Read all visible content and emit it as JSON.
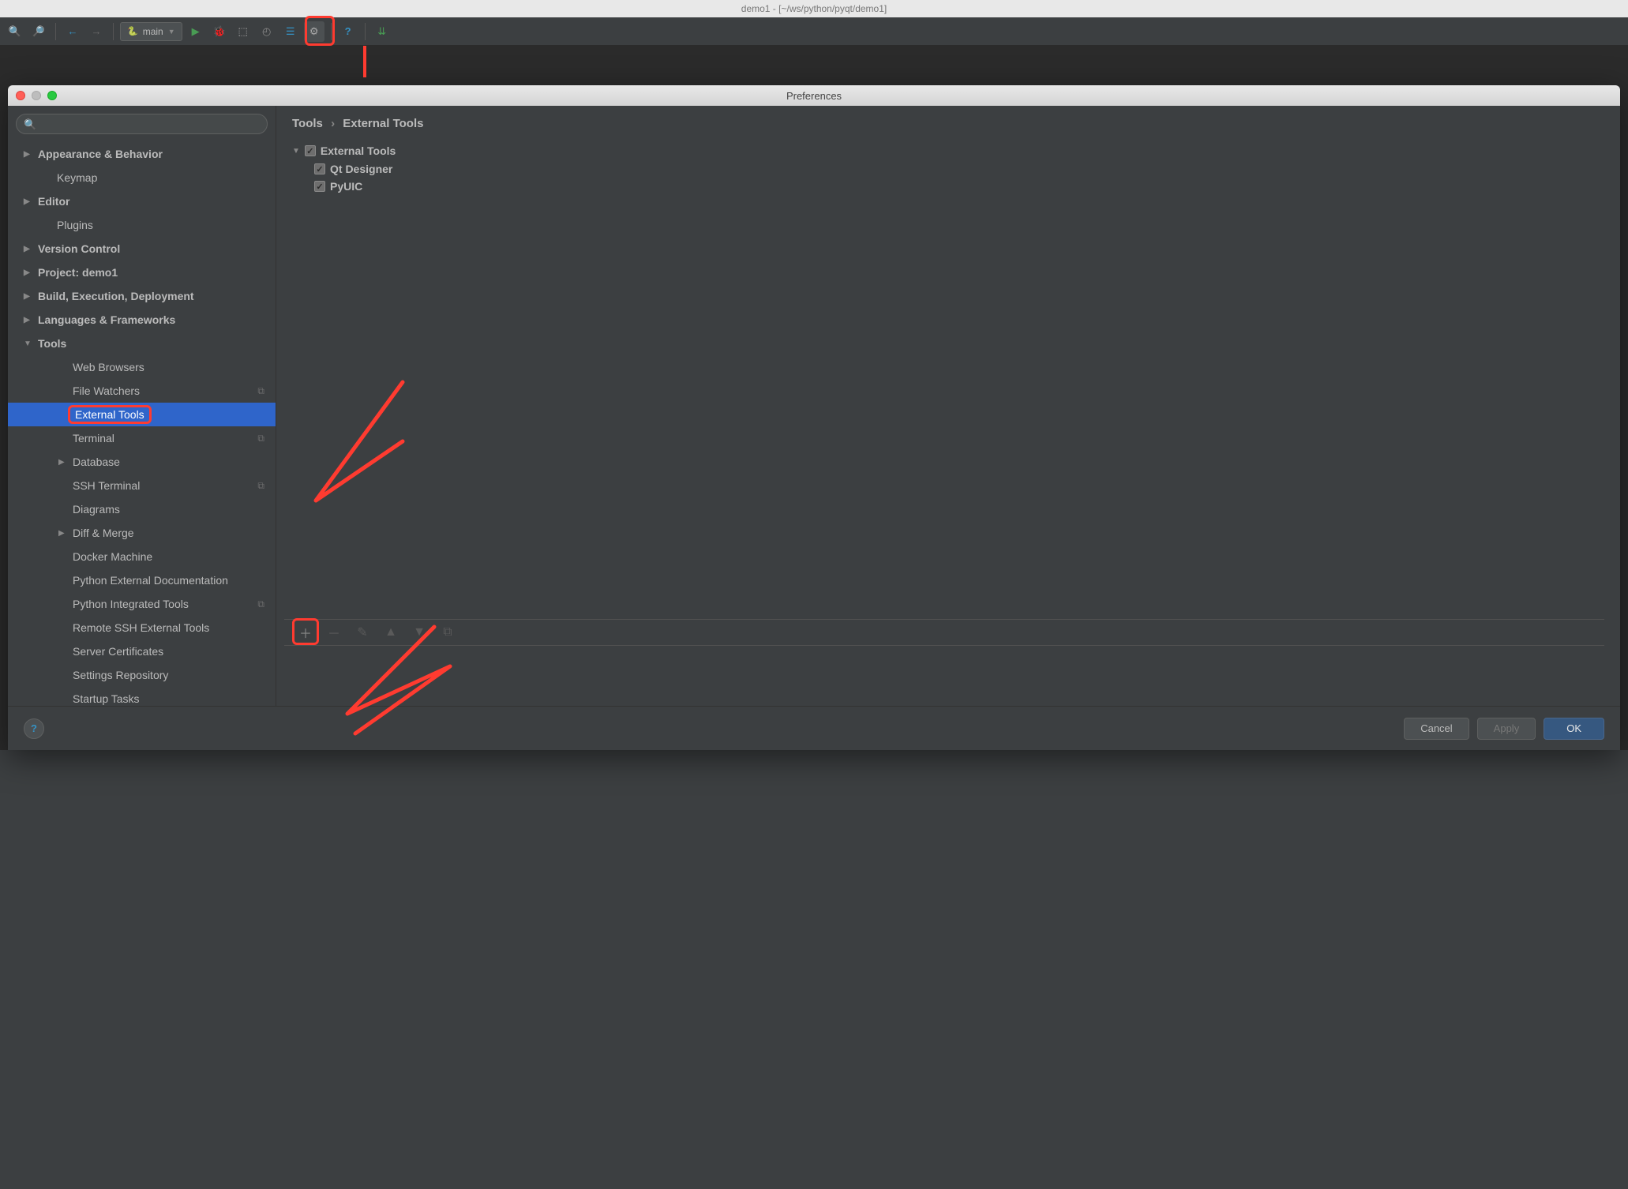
{
  "app_title": "demo1 - [~/ws/python/pyqt/demo1]",
  "run_config": "main",
  "dialog_title": "Preferences",
  "search_placeholder": "",
  "breadcrumb": {
    "root": "Tools",
    "leaf": "External Tools"
  },
  "sidebar": [
    {
      "label": "Appearance & Behavior",
      "arrow": "▶",
      "bold": true
    },
    {
      "label": "Keymap",
      "bold": true,
      "indent": 1
    },
    {
      "label": "Editor",
      "arrow": "▶",
      "bold": true
    },
    {
      "label": "Plugins",
      "bold": true,
      "indent": 1
    },
    {
      "label": "Version Control",
      "arrow": "▶",
      "bold": true
    },
    {
      "label": "Project: demo1",
      "arrow": "▶",
      "bold": true
    },
    {
      "label": "Build, Execution, Deployment",
      "arrow": "▶",
      "bold": true
    },
    {
      "label": "Languages & Frameworks",
      "arrow": "▶",
      "bold": true
    },
    {
      "label": "Tools",
      "arrow": "▼",
      "bold": true
    },
    {
      "label": "Web Browsers",
      "indent": 2
    },
    {
      "label": "File Watchers",
      "indent": 2,
      "copy": true
    },
    {
      "label": "External Tools",
      "indent": 2,
      "selected": true,
      "highlight": true
    },
    {
      "label": "Terminal",
      "indent": 2,
      "copy": true
    },
    {
      "label": "Database",
      "indent": 2,
      "arrow": "▶"
    },
    {
      "label": "SSH Terminal",
      "indent": 2,
      "copy": true
    },
    {
      "label": "Diagrams",
      "indent": 2
    },
    {
      "label": "Diff & Merge",
      "indent": 2,
      "arrow": "▶"
    },
    {
      "label": "Docker Machine",
      "indent": 2
    },
    {
      "label": "Python External Documentation",
      "indent": 2
    },
    {
      "label": "Python Integrated Tools",
      "indent": 2,
      "copy": true
    },
    {
      "label": "Remote SSH External Tools",
      "indent": 2
    },
    {
      "label": "Server Certificates",
      "indent": 2
    },
    {
      "label": "Settings Repository",
      "indent": 2
    },
    {
      "label": "Startup Tasks",
      "indent": 2
    }
  ],
  "ext_tools": {
    "group": "External Tools",
    "items": [
      "Qt Designer",
      "PyUIC"
    ]
  },
  "buttons": {
    "cancel": "Cancel",
    "apply": "Apply",
    "ok": "OK"
  }
}
